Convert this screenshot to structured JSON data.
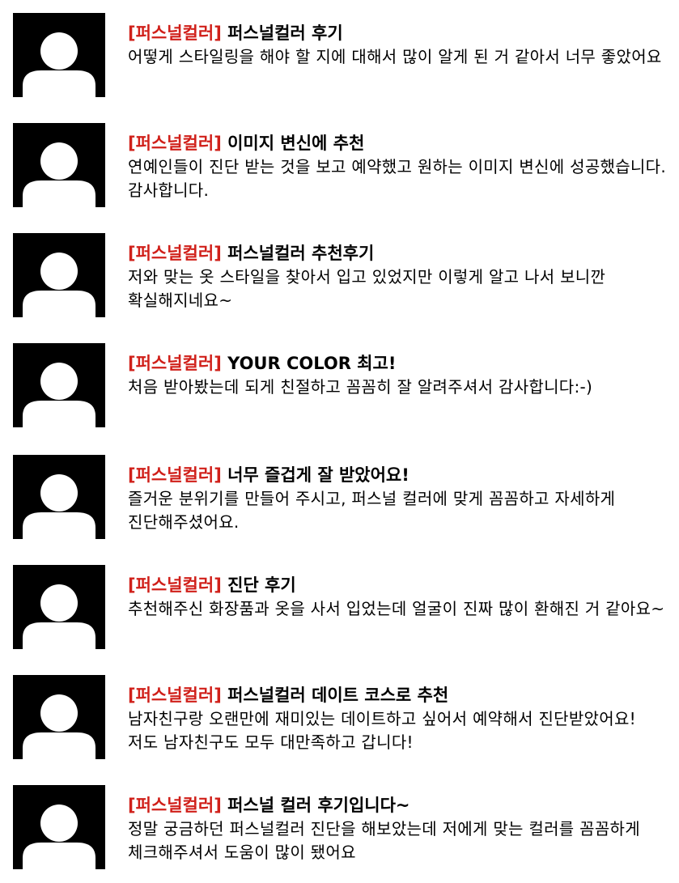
{
  "reviews": [
    {
      "tag": "[퍼스널컬러]",
      "title": "퍼스널컬러 후기",
      "body": "어떻게 스타일링을 해야 할 지에 대해서 많이 알게 된 거 같아서 너무 좋았어요",
      "avatar_icon": "user-silhouette-icon"
    },
    {
      "tag": "[퍼스널컬러]",
      "title": "이미지 변신에 추천",
      "body": "연예인들이 진단 받는 것을 보고 예약했고 원하는 이미지 변신에 성공했습니다. 감사합니다.",
      "avatar_icon": "user-silhouette-icon"
    },
    {
      "tag": "[퍼스널컬러]",
      "title": "퍼스널컬러 추천후기",
      "body": "저와 맞는 옷 스타일을 찾아서 입고 있었지만 이렇게 알고 나서 보니깐 확실해지네요~",
      "avatar_icon": "user-silhouette-icon"
    },
    {
      "tag": "[퍼스널컬러]",
      "title": "YOUR COLOR 최고!",
      "body": "처음 받아봤는데 되게 친절하고 꼼꼼히 잘 알려주셔서 감사합니다:-)",
      "avatar_icon": "user-silhouette-icon"
    },
    {
      "tag": "[퍼스널컬러]",
      "title": "너무 즐겁게 잘 받았어요!",
      "body": "즐거운 분위기를 만들어 주시고, 퍼스널 컬러에 맞게 꼼꼼하고 자세하게 진단해주셨어요.",
      "avatar_icon": "user-silhouette-icon"
    },
    {
      "tag": "[퍼스널컬러]",
      "title": "진단 후기",
      "body": "추천해주신 화장품과 옷을 사서 입었는데 얼굴이 진짜 많이 환해진 거 같아요~",
      "avatar_icon": "user-silhouette-icon"
    },
    {
      "tag": "[퍼스널컬러]",
      "title": "퍼스널컬러 데이트 코스로 추천",
      "body": "남자친구랑 오랜만에 재미있는 데이트하고 싶어서 예약해서 진단받았어요! 저도 남자친구도 모두 대만족하고 갑니다!",
      "avatar_icon": "user-silhouette-icon"
    },
    {
      "tag": "[퍼스널컬러]",
      "title": "퍼스널 컬러 후기입니다~",
      "body": "정말 궁금하던 퍼스널컬러 진단을 해보았는데 저에게 맞는 컬러를 꼼꼼하게 체크해주셔서 도움이 많이 됐어요",
      "avatar_icon": "user-silhouette-icon"
    }
  ]
}
